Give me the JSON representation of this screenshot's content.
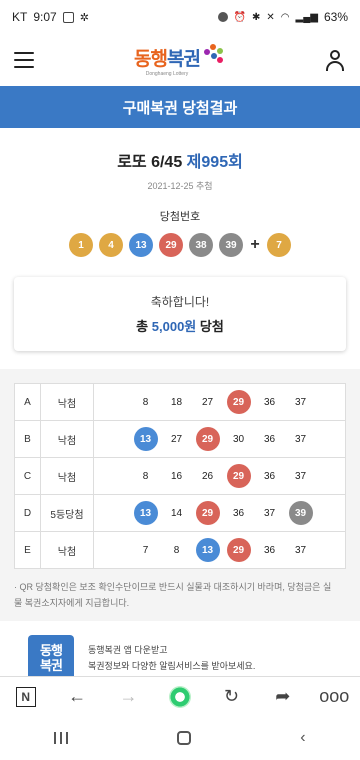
{
  "status": {
    "carrier": "KT",
    "time": "9:07",
    "battery": "63%"
  },
  "header": {
    "logo_main_a": "동행",
    "logo_main_b": "복권",
    "logo_sub": "Donghaeng Lottery"
  },
  "banner": {
    "title": "구매복권 당첨결과"
  },
  "draw": {
    "title_prefix": "로또 6/45",
    "round": "제995회",
    "date": "2021-12-25 추첨",
    "win_label": "당첨번호",
    "numbers": [
      "1",
      "4",
      "13",
      "29",
      "38",
      "39"
    ],
    "plus": "+",
    "bonus": "7"
  },
  "result": {
    "line1": "축하합니다!",
    "prefix": "총",
    "amount": "5,000원",
    "suffix": "당첨"
  },
  "games": [
    {
      "id": "A",
      "result": "낙첨",
      "nums": [
        "8",
        "18",
        "27",
        "29",
        "36",
        "37"
      ],
      "hits": [
        3
      ]
    },
    {
      "id": "B",
      "result": "낙첨",
      "nums": [
        "13",
        "27",
        "29",
        "30",
        "36",
        "37"
      ],
      "hits": [
        0,
        2
      ]
    },
    {
      "id": "C",
      "result": "낙첨",
      "nums": [
        "8",
        "16",
        "26",
        "29",
        "36",
        "37"
      ],
      "hits": [
        3
      ]
    },
    {
      "id": "D",
      "result": "5등당첨",
      "nums": [
        "13",
        "14",
        "29",
        "36",
        "37",
        "39"
      ],
      "hits": [
        0,
        2,
        5
      ]
    },
    {
      "id": "E",
      "result": "낙첨",
      "nums": [
        "7",
        "8",
        "13",
        "29",
        "36",
        "37"
      ],
      "hits": [
        2,
        3
      ]
    }
  ],
  "notice": "· QR 당첨확인은 보조 확인수단이므로 반드시 실물과 대조하시기 바라며, 당첨금은 실물 복권소지자에게 지급합니다.",
  "promo": {
    "logo_a": "동행",
    "logo_b": "복권",
    "line1": "동행복권 앱 다운받고",
    "line2": "복권정보와 다양한 알림서비스를 받아보세요."
  },
  "ball_colors": {
    "1": "#dfa843",
    "4": "#dfa843",
    "7": "#dfa843",
    "8": "#dfa843",
    "13": "#4a8bd6",
    "14": "#4a8bd6",
    "16": "#4a8bd6",
    "18": "#4a8bd6",
    "26": "#d86459",
    "27": "#d86459",
    "29": "#d86459",
    "30": "#8a8a8a",
    "36": "#8a8a8a",
    "37": "#8a8a8a",
    "38": "#8a8a8a",
    "39": "#8a8a8a"
  },
  "colors": {
    "accent": "#3a79c5",
    "brand_orange": "#e8641e",
    "win_amount": "#2f67b5"
  }
}
